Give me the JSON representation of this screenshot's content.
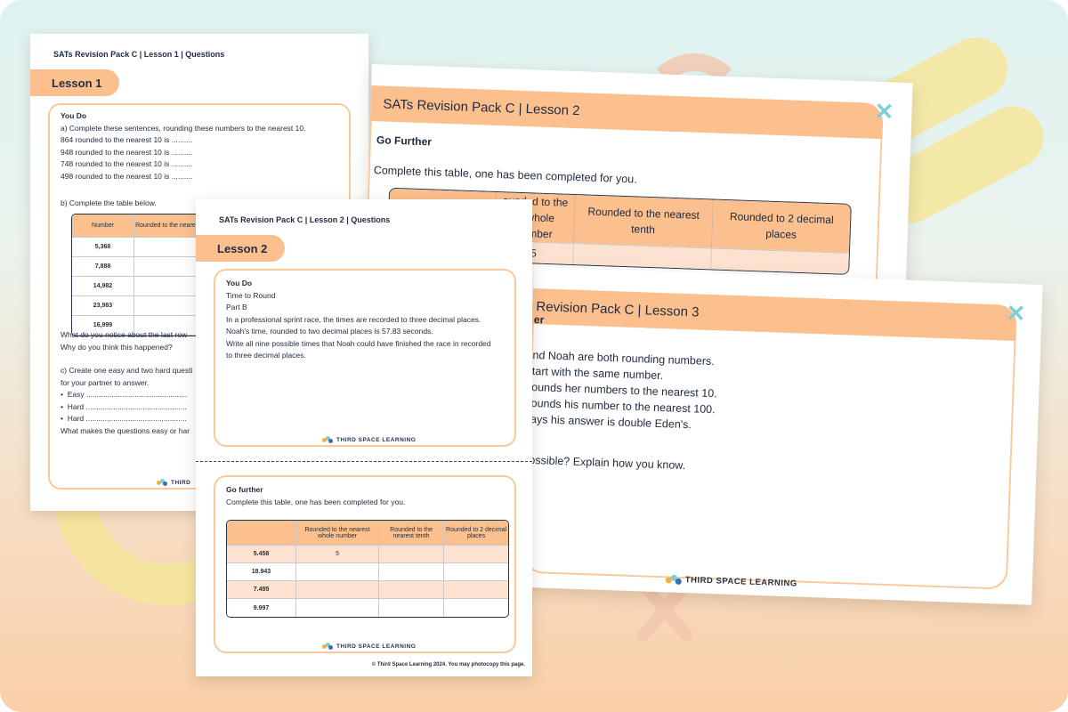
{
  "colors": {
    "accent": "#fcc08f",
    "border": "#fbc89c",
    "teal": "#7ccfd6"
  },
  "doc1": {
    "header": "SATs Revision Pack C | Lesson 1 | Questions",
    "tab": "Lesson 1",
    "you_do": "You Do",
    "qa": "a) Complete these sentences, rounding these numbers to the nearest 10.",
    "lines": [
      "864 rounded to the nearest 10 is ..........",
      "948 rounded to the nearest 10 is ..........",
      "748 rounded to the nearest 10 is ..........",
      "498 rounded to the nearest 10 is .........."
    ],
    "qb": "b) Complete the table below.",
    "table_headers": [
      "Number",
      "Rounded to the nearest ten"
    ],
    "table_rows": [
      "5,368",
      "7,888",
      "14,982",
      "23,983",
      "16,999"
    ],
    "notice1": "What do you notice about the last row",
    "notice2": "Why do you think this happened?",
    "qc1": "c) Create one easy and two hard questi",
    "qc2": "for your partner to answer.",
    "bullets": [
      "Easy ................................................",
      "Hard ................................................",
      "Hard ................................................"
    ],
    "makes": "What makes the questions easy or har",
    "logo": "THIRD"
  },
  "slide2": {
    "title": "SATs Revision Pack C | Lesson 2",
    "subtitle": "Go Further",
    "instruction": "Complete this table, one has been completed for you.",
    "headers": [
      "Rounded to the nearest whole number",
      "Rounded to the nearest tenth",
      "Rounded to 2 decimal places"
    ],
    "header_col1_line1": "ounded to the",
    "header_col1_line2": "st whole number",
    "row1_value": "5"
  },
  "slide3": {
    "title": "Revision Pack C | Lesson 3",
    "subtitle": "er",
    "lines": [
      "nd Noah are both rounding numbers.",
      "tart with the same number.",
      "ounds her numbers to the nearest 10.",
      "ounds his number to the nearest 100.",
      "ays his answer is double Eden's."
    ],
    "question": "ossible? Explain how you know.",
    "logo": "THIRD SPACE LEARNING"
  },
  "doc2": {
    "header": "SATs Revision Pack C | Lesson 2 | Questions",
    "tab": "Lesson 2",
    "you_do": "You Do",
    "lines": [
      "Time to Round",
      "Part B",
      "In a professional sprint race, the times are recorded to three decimal places.",
      "Noah's time, rounded to two decimal places is 57.83 seconds.",
      "Write all nine possible times that Noah could have finished the race in recorded",
      "to three decimal places."
    ],
    "logo": "THIRD SPACE LEARNING",
    "go_further": "Go further",
    "instruction": "Complete this table, one has been completed for you.",
    "table_headers": [
      "",
      "Rounded to the nearest whole number",
      "Rounded to the nearest tenth",
      "Rounded to 2 decimal places"
    ],
    "table_rows": [
      [
        "5.458",
        "5",
        "",
        ""
      ],
      [
        "18.943",
        "",
        "",
        ""
      ],
      [
        "7.495",
        "",
        "",
        ""
      ],
      [
        "9.997",
        "",
        "",
        ""
      ]
    ],
    "footer": "© Third Space Learning 2024. You may photocopy this page."
  }
}
